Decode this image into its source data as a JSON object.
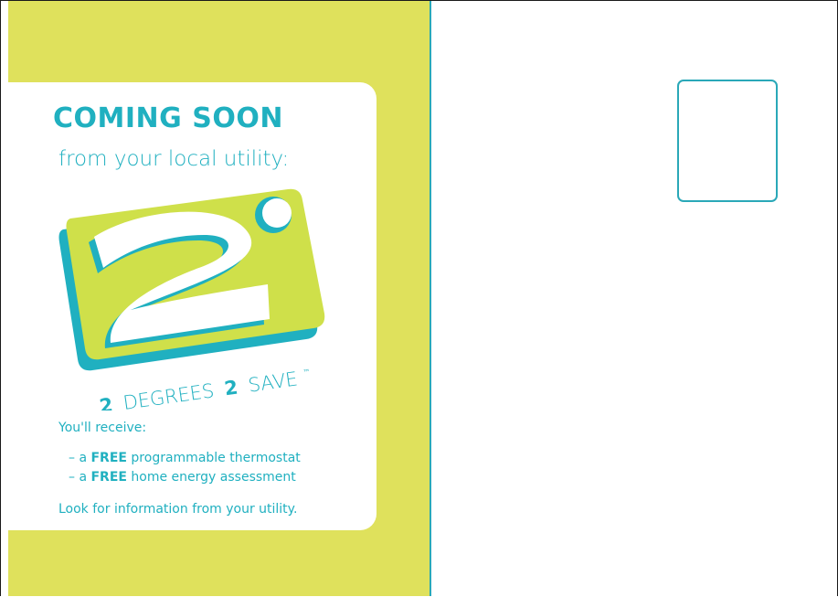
{
  "postcard": {
    "headline": "COMING SOON",
    "subheadline": "from your local utility:",
    "logo": {
      "big_digit": "2",
      "wordmark_num1": "2",
      "wordmark_word1": "DEGREES",
      "wordmark_num2": "2",
      "wordmark_word2": "SAVE",
      "trademark": "™"
    },
    "receive_heading": "You'll receive:",
    "benefits": [
      {
        "prefix": "– a ",
        "bold": "FREE",
        "suffix": " programmable thermostat"
      },
      {
        "prefix": "– a ",
        "bold": "FREE",
        "suffix": " home energy assessment"
      }
    ],
    "footer_note": "Look for information from your utility."
  },
  "colors": {
    "background_yellow": "#dfe15c",
    "accent_teal": "#20b0c0",
    "logo_lime": "#cfe04a",
    "card_white": "#ffffff"
  }
}
